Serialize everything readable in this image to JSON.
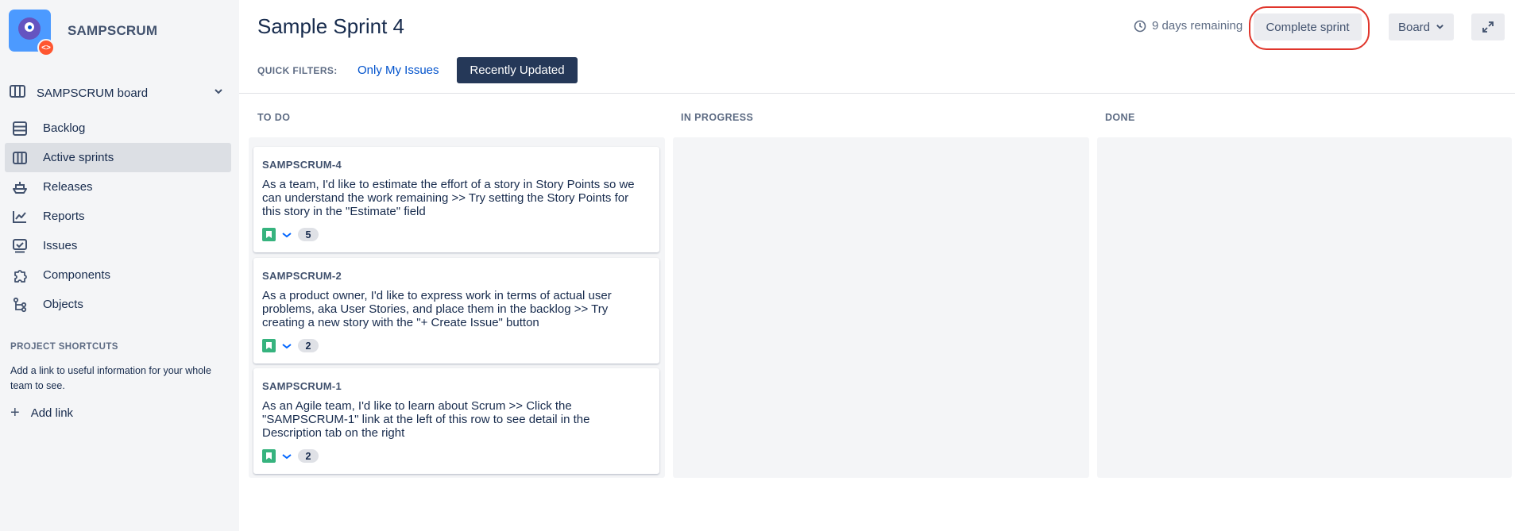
{
  "project": {
    "name": "SAMPSCRUM",
    "avatar_badge": "<>"
  },
  "sidebar": {
    "board_selector": "SAMPSCRUM board",
    "items": [
      {
        "label": "Backlog",
        "icon": "backlog-icon",
        "active": false
      },
      {
        "label": "Active sprints",
        "icon": "board-icon",
        "active": true
      },
      {
        "label": "Releases",
        "icon": "ship-icon",
        "active": false
      },
      {
        "label": "Reports",
        "icon": "chart-icon",
        "active": false
      },
      {
        "label": "Issues",
        "icon": "issues-icon",
        "active": false
      },
      {
        "label": "Components",
        "icon": "puzzle-icon",
        "active": false
      },
      {
        "label": "Objects",
        "icon": "tree-icon",
        "active": false
      }
    ],
    "shortcuts_title": "PROJECT SHORTCUTS",
    "shortcuts_desc": "Add a link to useful information for your whole team to see.",
    "add_link": "Add link"
  },
  "header": {
    "title": "Sample Sprint 4",
    "remaining": "9 days remaining",
    "complete_button": "Complete sprint",
    "board_button": "Board"
  },
  "quick_filters": {
    "label": "QUICK FILTERS:",
    "filters": [
      {
        "label": "Only My Issues",
        "active": false
      },
      {
        "label": "Recently Updated",
        "active": true
      }
    ]
  },
  "columns": [
    {
      "title": "TO DO"
    },
    {
      "title": "IN PROGRESS"
    },
    {
      "title": "DONE"
    }
  ],
  "cards": [
    {
      "key": "SAMPSCRUM-4",
      "summary": "As a team, I'd like to estimate the effort of a story in Story Points so we can understand the work remaining >> Try setting the Story Points for this story in the \"Estimate\" field",
      "points": "5"
    },
    {
      "key": "SAMPSCRUM-2",
      "summary": "As a product owner, I'd like to express work in terms of actual user problems, aka User Stories, and place them in the backlog >> Try creating a new story with the \"+ Create Issue\" button",
      "points": "2"
    },
    {
      "key": "SAMPSCRUM-1",
      "summary": "As an Agile team, I'd like to learn about Scrum >> Click the \"SAMPSCRUM-1\" link at the left of this row to see detail in the Description tab on the right",
      "points": "2"
    }
  ],
  "colors": {
    "sidebar_bg": "#f4f5f7",
    "active_item_bg": "#dcdfe4",
    "link_blue": "#0052cc",
    "filter_active_bg": "#253858",
    "story_green": "#36b37e",
    "highlight_red": "#e0352b"
  }
}
